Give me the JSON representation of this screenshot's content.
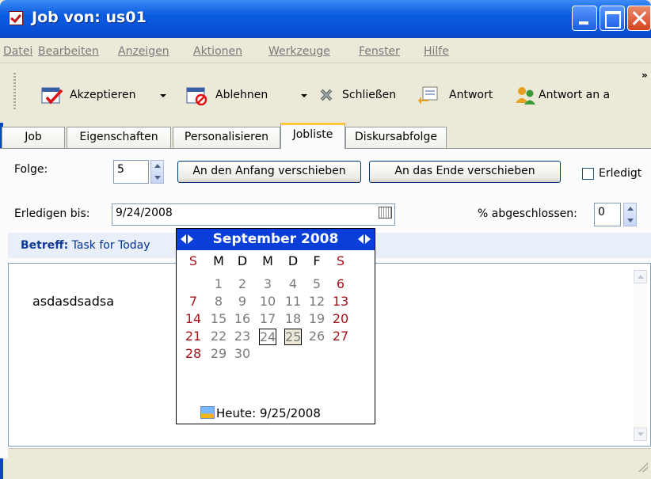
{
  "window": {
    "title": "Job von: us01"
  },
  "menu": [
    "Datei",
    "Bearbeiten",
    "Anzeigen",
    "Aktionen",
    "Werkzeuge",
    "Fenster",
    "Hilfe"
  ],
  "toolbar": {
    "accept_label": "Akzeptieren",
    "decline_label": "Ablehnen",
    "close_label": "Schließen",
    "reply_label": "Antwort",
    "reply_to_label": "Antwort an a",
    "more_label": "»"
  },
  "tabs": [
    "Job",
    "Eigenschaften",
    "Personalisieren",
    "Jobliste",
    "Diskursabfolge"
  ],
  "active_tab": "Jobliste",
  "form": {
    "folge_label": "Folge:",
    "folge_value": "5",
    "move_start_label": "An den Anfang verschieben",
    "move_end_label": "An das Ende verschieben",
    "done_label": "Erledigt",
    "due_label": "Erledigen bis:",
    "due_value": "9/24/2008",
    "percent_label": "% abgeschlossen:",
    "percent_value": "0"
  },
  "subject": {
    "label": "Betreff:",
    "value": "Task for Today"
  },
  "body_text": "asdasdsadsa",
  "calendar": {
    "month_title": "September 2008",
    "weekday_headers": [
      "S",
      "M",
      "D",
      "M",
      "D",
      "F",
      "S"
    ],
    "weeks": [
      [
        "",
        "1",
        "2",
        "3",
        "4",
        "5",
        "6"
      ],
      [
        "7",
        "8",
        "9",
        "10",
        "11",
        "12",
        "13"
      ],
      [
        "14",
        "15",
        "16",
        "17",
        "18",
        "19",
        "20"
      ],
      [
        "21",
        "22",
        "23",
        "24",
        "25",
        "26",
        "27"
      ],
      [
        "28",
        "29",
        "30",
        "",
        "",
        "",
        ""
      ]
    ],
    "selected_day": "24",
    "today_day": "25",
    "today_label": "Heute: 9/25/2008"
  },
  "colors": {
    "titlebar": "#0A5BE0",
    "calendar_header": "#0A3ED8",
    "weekend_red": "#A3141A",
    "tab_highlight": "#FFC83C"
  }
}
